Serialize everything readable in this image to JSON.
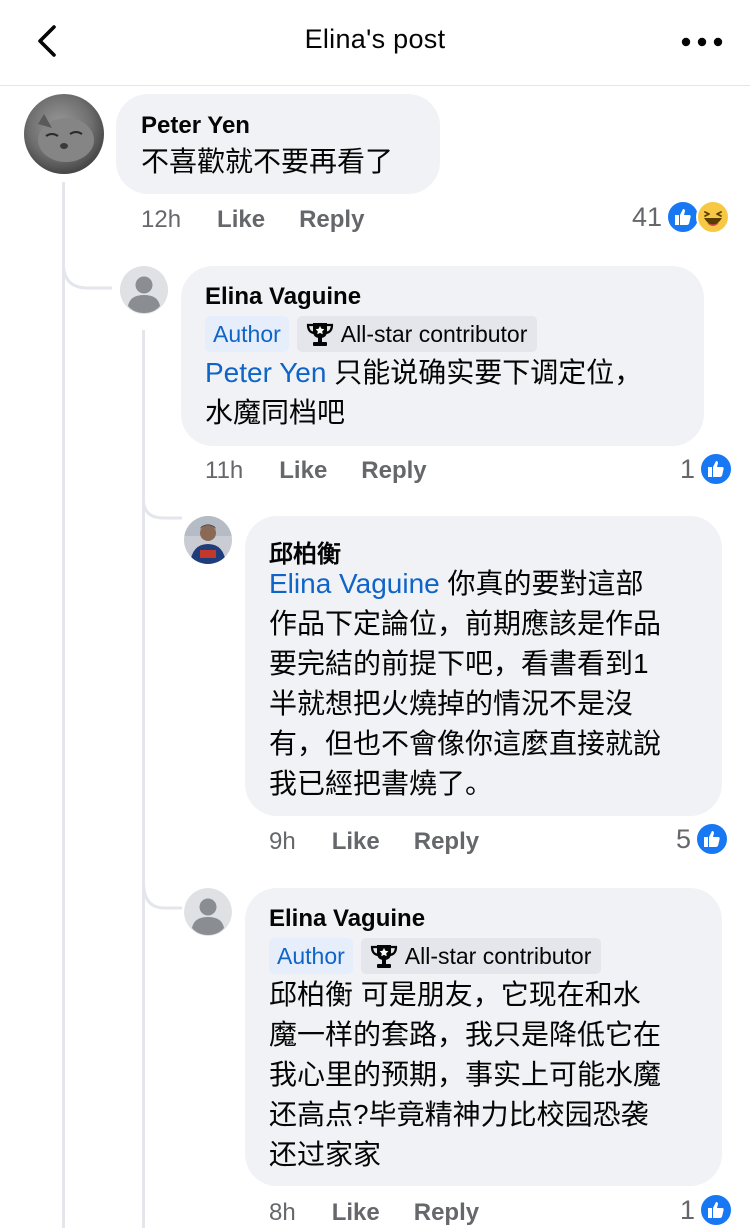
{
  "header": {
    "title": "Elina's post",
    "back_icon": "chevron-left-icon",
    "menu_icon": "more-horizontal-icon"
  },
  "comments": [
    {
      "author": "Peter Yen",
      "text": "不喜歡就不要再看了",
      "time": "12h",
      "like_label": "Like",
      "reply_label": "Reply",
      "reaction_count": "41",
      "reactions": [
        "like-icon",
        "haha-icon"
      ]
    },
    {
      "author": "Elina Vaguine",
      "author_tag": "Author",
      "badge": "All-star contributor",
      "mention": "Peter Yen",
      "text_line1": " 只能说确实要下调定位，",
      "text_line2": "水魔同档吧",
      "time": "11h",
      "like_label": "Like",
      "reply_label": "Reply",
      "reaction_count": "1",
      "reactions": [
        "like-icon"
      ]
    },
    {
      "author": "邱柏衡",
      "mention": "Elina Vaguine",
      "text_line1": " 你真的要對這部",
      "text_rest": "作品下定論位，前期應該是作品\n要完結的前提下吧，看書看到1\n半就想把火燒掉的情況不是沒\n有，但也不會像你這麼直接就說\n我已經把書燒了。",
      "time": "9h",
      "like_label": "Like",
      "reply_label": "Reply",
      "reaction_count": "5",
      "reactions": [
        "like-icon"
      ]
    },
    {
      "author": "Elina Vaguine",
      "author_tag": "Author",
      "badge": "All-star contributor",
      "text": "邱柏衡 可是朋友，它现在和水\n魔一样的套路，我只是降低它在\n我心里的预期，事实上可能水魔\n还高点?毕竟精神力比校园恐袭\n还过家家",
      "time": "8h",
      "like_label": "Like",
      "reply_label": "Reply",
      "reaction_count": "1",
      "reactions": [
        "like-icon"
      ]
    }
  ],
  "colors": {
    "bubble": "#f0f2f5",
    "link": "#0f64c8",
    "like_blue": "#1877f2",
    "meta_gray": "#65676b"
  }
}
